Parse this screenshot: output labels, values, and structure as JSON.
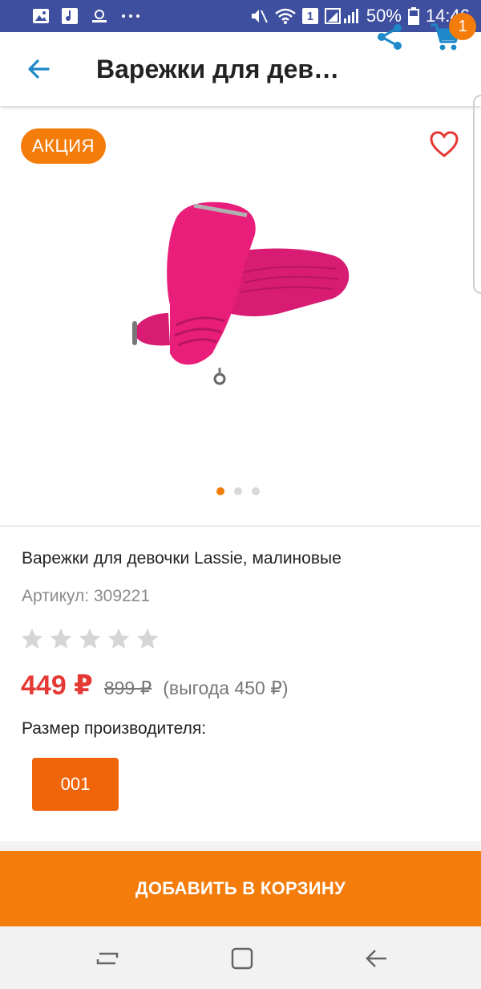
{
  "status_bar": {
    "battery_text": "50%",
    "time": "14:46",
    "sim_badge": "1",
    "icons": [
      "image-icon",
      "music-icon",
      "voicemail-icon",
      "more-dots-icon",
      "mute-icon",
      "wifi-icon",
      "signal-icon",
      "battery-icon"
    ]
  },
  "app_bar": {
    "title": "Варежки для дев…",
    "cart_count": "1",
    "accent_color": "#1e88c9"
  },
  "product": {
    "promo_badge": "АКЦИЯ",
    "name": "Варежки для девочки Lassie, малиновые",
    "sku": "Артикул: 309221",
    "rating": 0,
    "rating_max": 5,
    "price": "449 ₽",
    "old_price": "899 ₽",
    "saving": "(выгода 450 ₽)",
    "size_label": "Размер производителя:",
    "sizes": [
      "001"
    ],
    "carousel": {
      "count": 3,
      "active": 0
    }
  },
  "cta": {
    "label": "ДОБАВИТЬ В КОРЗИНУ",
    "color": "#f47c0a"
  },
  "colors": {
    "price": "#e53935",
    "accent_orange": "#f47c0a",
    "status_bar": "#3f4fa0"
  }
}
